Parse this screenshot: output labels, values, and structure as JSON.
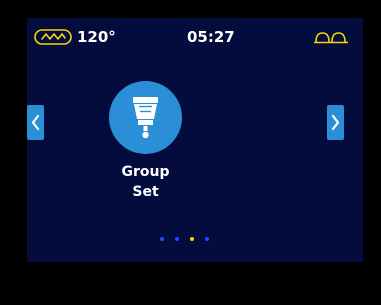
{
  "status_bar": {
    "temperature_icon": "boiler-wave-icon",
    "temperature": "120°",
    "clock": "05:27",
    "cups_icon": "double-cup-icon"
  },
  "menu": {
    "current_item": {
      "icon": "group-head-icon",
      "label": "Group\nSet"
    },
    "page_count": 4,
    "active_page": 3
  },
  "colors": {
    "screen_bg": "#040b3d",
    "accent_blue": "#2a8fd6",
    "status_yellow": "#f5d800",
    "dot_inactive": "#1f4cff",
    "dot_active": "#f5d800"
  }
}
